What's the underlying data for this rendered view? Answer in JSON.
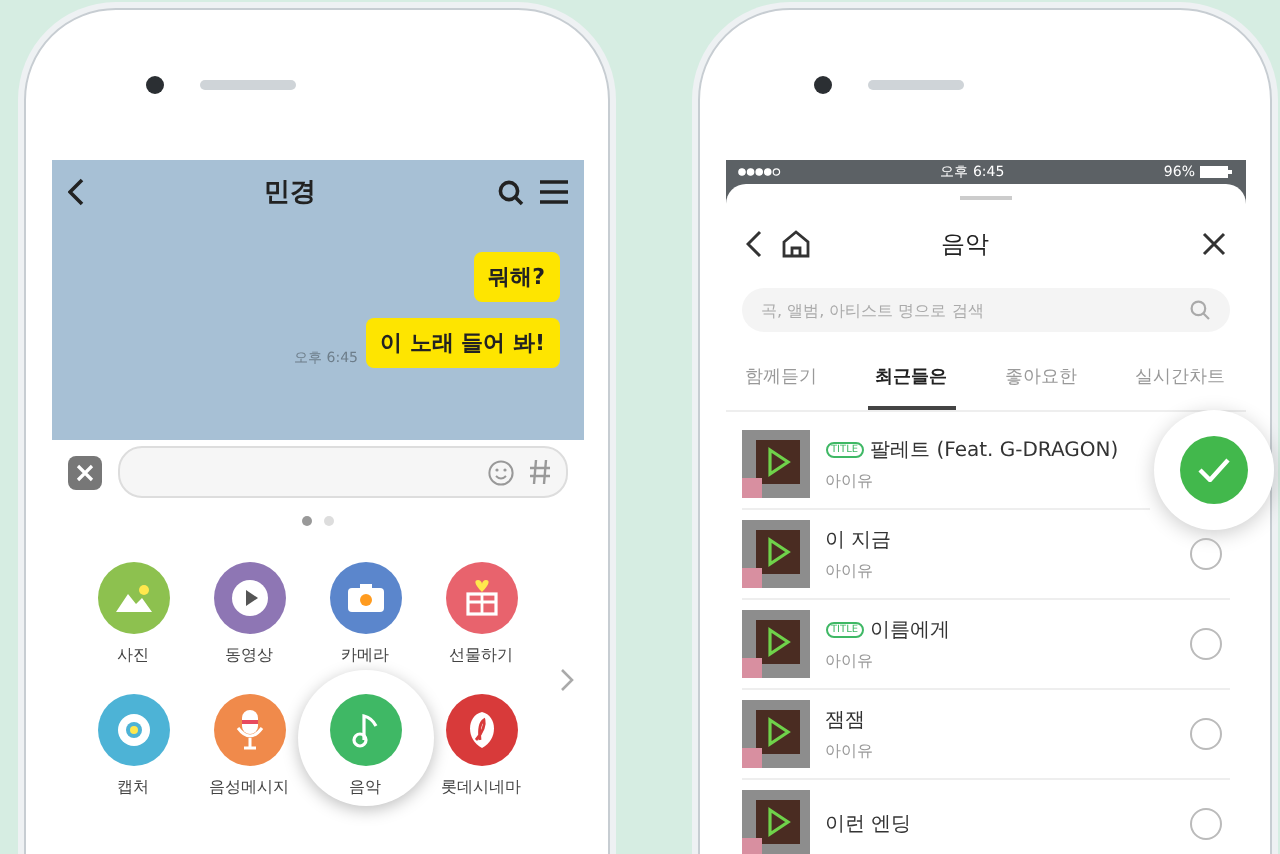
{
  "chat": {
    "title": "민경",
    "messages": [
      {
        "text": "뭐해?"
      },
      {
        "text": "이 노래 들어 봐!",
        "time": "오후 6:45"
      }
    ]
  },
  "pager": [
    {
      "selected": true
    },
    {
      "selected": false
    }
  ],
  "attachments": [
    {
      "label": "사진",
      "kind": "photo",
      "color": "#8dc14f",
      "highlighted": false
    },
    {
      "label": "동영상",
      "kind": "video",
      "color": "#8e76b4",
      "highlighted": false
    },
    {
      "label": "카메라",
      "kind": "camera",
      "color": "#5b86cc",
      "highlighted": false
    },
    {
      "label": "선물하기",
      "kind": "gift",
      "color": "#e8636d",
      "highlighted": false
    },
    {
      "label": "캡처",
      "kind": "capture",
      "color": "#4db3d6",
      "highlighted": false
    },
    {
      "label": "음성메시지",
      "kind": "voice",
      "color": "#f08a4b",
      "highlighted": false
    },
    {
      "label": "음악",
      "kind": "music",
      "color": "#3fb865",
      "highlighted": true
    },
    {
      "label": "롯데시네마",
      "kind": "cinema",
      "color": "#d83a3a",
      "highlighted": false
    }
  ],
  "status_bar": {
    "time": "오후 6:45",
    "battery": "96%"
  },
  "music": {
    "title": "음악",
    "search": {
      "placeholder": "곡, 앨범, 아티스트 명으로 검색"
    },
    "tabs": [
      {
        "label": "함께듣기",
        "selected": false
      },
      {
        "label": "최근들은",
        "selected": true
      },
      {
        "label": "좋아요한",
        "selected": false
      },
      {
        "label": "실시간차트",
        "selected": false
      }
    ],
    "songs": [
      {
        "badge": "TITLE",
        "title": "팔레트 (Feat. G-DRAGON)",
        "artist": "아이유",
        "selected": true
      },
      {
        "title": "이 지금",
        "artist": "아이유",
        "selected": false
      },
      {
        "badge": "TITLE",
        "title": "이름에게",
        "artist": "아이유",
        "selected": false
      },
      {
        "title": "잼잼",
        "artist": "아이유",
        "selected": false
      },
      {
        "title": "이런 엔딩",
        "selected": false
      }
    ]
  }
}
